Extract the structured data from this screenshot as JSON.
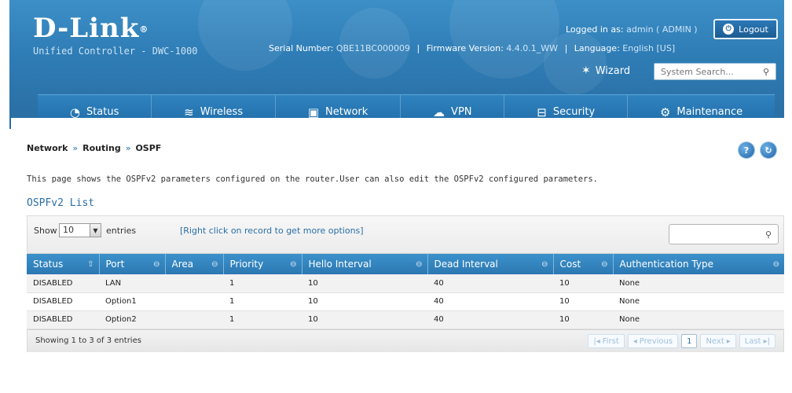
{
  "header": {
    "logo": "D-Link",
    "logo_reg": "®",
    "product": "Unified Controller - DWC-1000",
    "logged_in_label": "Logged in as:",
    "logged_in_user": "admin ( ADMIN )",
    "logout_label": "Logout",
    "serial_label": "Serial Number:",
    "serial_value": "QBE11BC000009",
    "firmware_label": "Firmware Version:",
    "firmware_value": "4.4.0.1_WW",
    "language_label": "Language:",
    "language_value": "English [US]",
    "wizard_label": "Wizard",
    "search_placeholder": "System Search..."
  },
  "nav": {
    "items": [
      {
        "label": "Status",
        "icon": "gauge-icon"
      },
      {
        "label": "Wireless",
        "icon": "wifi-icon"
      },
      {
        "label": "Network",
        "icon": "monitor-icon",
        "active": true
      },
      {
        "label": "VPN",
        "icon": "cloud-icon"
      },
      {
        "label": "Security",
        "icon": "lock-icon"
      },
      {
        "label": "Maintenance",
        "icon": "gears-icon"
      }
    ]
  },
  "breadcrumb": [
    "Network",
    "Routing",
    "OSPF"
  ],
  "description": "This page shows the OSPFv2 parameters configured on the router.User can also edit the OSPFv2 configured parameters.",
  "section_title": "OSPFv2 List",
  "toolbar": {
    "show_label": "Show",
    "entries_value": "10",
    "entries_label": "entries",
    "hint": "[Right click on record to get more options]"
  },
  "table": {
    "columns": [
      "Status",
      "Port",
      "Area",
      "Priority",
      "Hello Interval",
      "Dead Interval",
      "Cost",
      "Authentication Type"
    ],
    "rows": [
      [
        "DISABLED",
        "LAN",
        "",
        "1",
        "10",
        "40",
        "10",
        "None"
      ],
      [
        "DISABLED",
        "Option1",
        "",
        "1",
        "10",
        "40",
        "10",
        "None"
      ],
      [
        "DISABLED",
        "Option2",
        "",
        "1",
        "10",
        "40",
        "10",
        "None"
      ]
    ]
  },
  "footer": {
    "showing": "Showing 1 to 3 of 3 entries",
    "pager": {
      "first": "First",
      "previous": "Previous",
      "current": "1",
      "next": "Next",
      "last": "Last"
    }
  },
  "colors": {
    "header_blue": "#2f7db6",
    "accent": "#2a6fa8"
  }
}
